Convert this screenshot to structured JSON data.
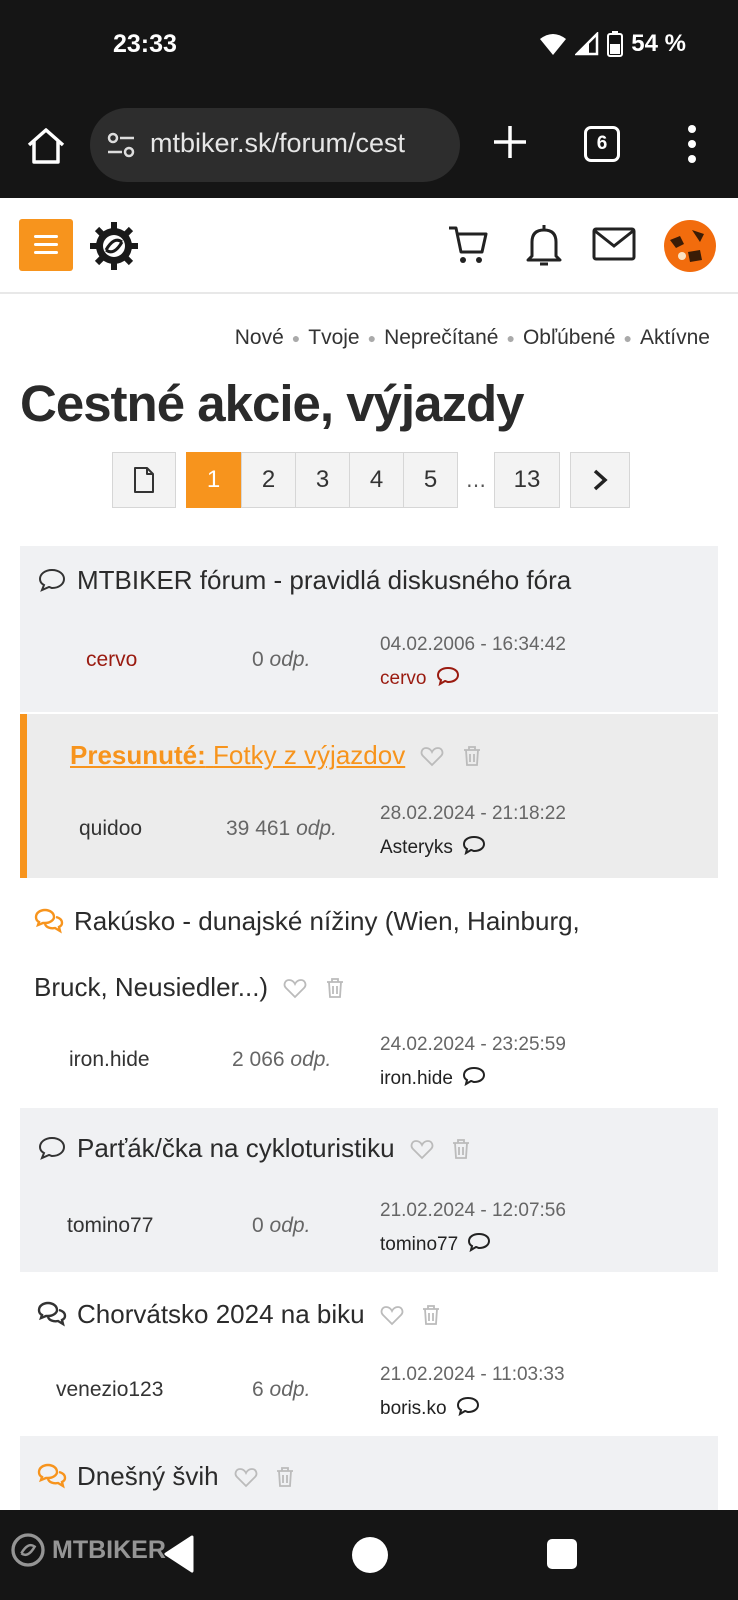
{
  "status_bar": {
    "time": "23:33",
    "battery": "54 %"
  },
  "browser": {
    "url": "mtbiker.sk/forum/cest",
    "tab_count": "6"
  },
  "subnav": [
    "Nové",
    "Tvoje",
    "Neprečítané",
    "Obľúbené",
    "Aktívne"
  ],
  "page_title": "Cestné akcie, výjazdy",
  "pagination": {
    "pages": [
      "1",
      "2",
      "3",
      "4",
      "5"
    ],
    "ellipsis": "…",
    "last": "13",
    "current": "1"
  },
  "topics": [
    {
      "title": "MTBIKER fórum - pravidlá diskusného fóra",
      "author": "cervo",
      "replies": "0",
      "replies_label": "odp.",
      "date": "04.02.2006 - 16:34:42",
      "last_user": "cervo"
    },
    {
      "moved_prefix": "Presunuté:",
      "title": "Fotky z výjazdov",
      "author": "quidoo",
      "replies": "39 461",
      "replies_label": "odp.",
      "date": "28.02.2024 - 21:18:22",
      "last_user": "Asteryks"
    },
    {
      "title_line1": "Rakúsko - dunajské nížiny (Wien, Hainburg,",
      "title_line2": "Bruck, Neusiedler...)",
      "author": "iron.hide",
      "replies": "2 066",
      "replies_label": "odp.",
      "date": "24.02.2024 - 23:25:59",
      "last_user": "iron.hide"
    },
    {
      "title": "Parťák/čka na cykloturistiku",
      "author": "tomino77",
      "replies": "0",
      "replies_label": "odp.",
      "date": "21.02.2024 - 12:07:56",
      "last_user": "tomino77"
    },
    {
      "title": "Chorvátsko 2024 na biku",
      "author": "venezio123",
      "replies": "6",
      "replies_label": "odp.",
      "date": "21.02.2024 - 11:03:33",
      "last_user": "boris.ko"
    },
    {
      "title": "Dnešný švih"
    }
  ],
  "watermark": "MTBIKER",
  "colors": {
    "accent": "#f7941d",
    "admin_red": "#9a1b10",
    "system_bar": "#151515"
  }
}
